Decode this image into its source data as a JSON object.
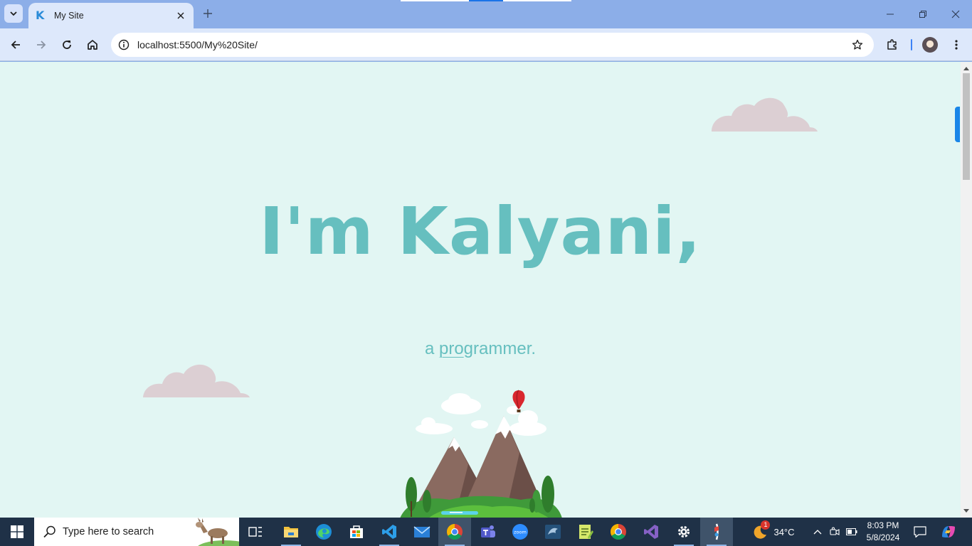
{
  "browser": {
    "tab_title": "My Site",
    "favicon_letter": "K",
    "url": "localhost:5500/My%20Site/"
  },
  "page": {
    "heading": "I'm Kalyani,",
    "subtitle_prefix": "a ",
    "subtitle_underlined": "pro",
    "subtitle_rest": "grammer."
  },
  "taskbar": {
    "search_placeholder": "Type here to search",
    "weather_temp": "34°C",
    "weather_badge": "1",
    "time": "8:03 PM",
    "date": "5/8/2024",
    "apps": [
      "task-view",
      "file-explorer",
      "edge",
      "microsoft-store",
      "vscode",
      "mail",
      "chrome-active",
      "teams",
      "zoom",
      "mysql-workbench",
      "notepad-plus",
      "chrome",
      "visual-studio",
      "settings",
      "git-tool"
    ]
  },
  "colors": {
    "page_bg": "#e2f6f3",
    "accent": "#66bfbf",
    "cloud": "#dccfd3",
    "taskbar": "#1f3147",
    "chrome": "#dde8fb"
  }
}
